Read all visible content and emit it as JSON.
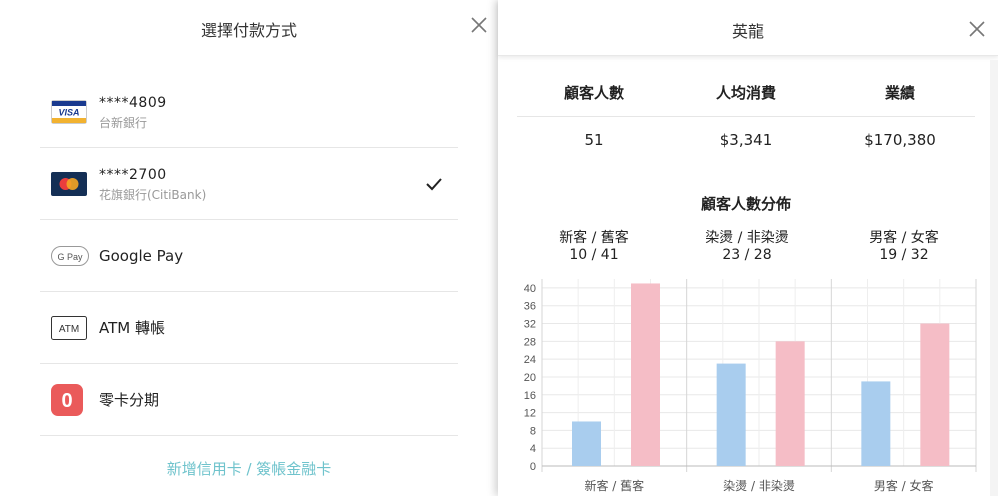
{
  "payment": {
    "title": "選擇付款方式",
    "methods": [
      {
        "line1": "****4809",
        "line2": "台新銀行",
        "icon": "visa-card-icon"
      },
      {
        "line1": "****2700",
        "line2": "花旗銀行(CitiBank)",
        "icon": "mastercard-icon",
        "selected": true
      },
      {
        "line1": "Google Pay",
        "icon": "google-pay-icon"
      },
      {
        "line1": "ATM 轉帳",
        "icon": "atm-icon"
      },
      {
        "line1": "零卡分期",
        "icon": "zero-card-icon"
      }
    ],
    "add_card_label": "新增信用卡 / 簽帳金融卡",
    "visa_text": "VISA",
    "gpay_text": "G Pay",
    "atm_text": "ATM",
    "zero_text": "0"
  },
  "report": {
    "title": "英龍",
    "stats": [
      {
        "label": "顧客人數",
        "value": "51"
      },
      {
        "label": "人均消費",
        "value": "$3,341"
      },
      {
        "label": "業績",
        "value": "$170,380"
      }
    ],
    "distribution_title": "顧客人數分佈",
    "groups": [
      {
        "label": "新客 / 舊客",
        "value": "10 / 41"
      },
      {
        "label": "染燙 / 非染燙",
        "value": "23 / 28"
      },
      {
        "label": "男客 / 女客",
        "value": "19 / 32"
      }
    ]
  },
  "colors": {
    "accent": "#6fc3cc",
    "bar_blue": "#a9cdee",
    "bar_pink": "#f5bdc6",
    "zero_card": "#ea5a5a"
  },
  "chart_data": {
    "type": "bar",
    "categories": [
      "新客 / 舊客",
      "染燙 / 非染燙",
      "男客 / 女客"
    ],
    "series": [
      {
        "values": [
          10,
          23,
          19
        ]
      },
      {
        "values": [
          41,
          28,
          32
        ]
      }
    ],
    "yticks": [
      "0",
      "4",
      "8",
      "12",
      "16",
      "20",
      "24",
      "28",
      "32",
      "36",
      "40"
    ],
    "ylim": [
      0,
      42
    ],
    "grid": true
  }
}
